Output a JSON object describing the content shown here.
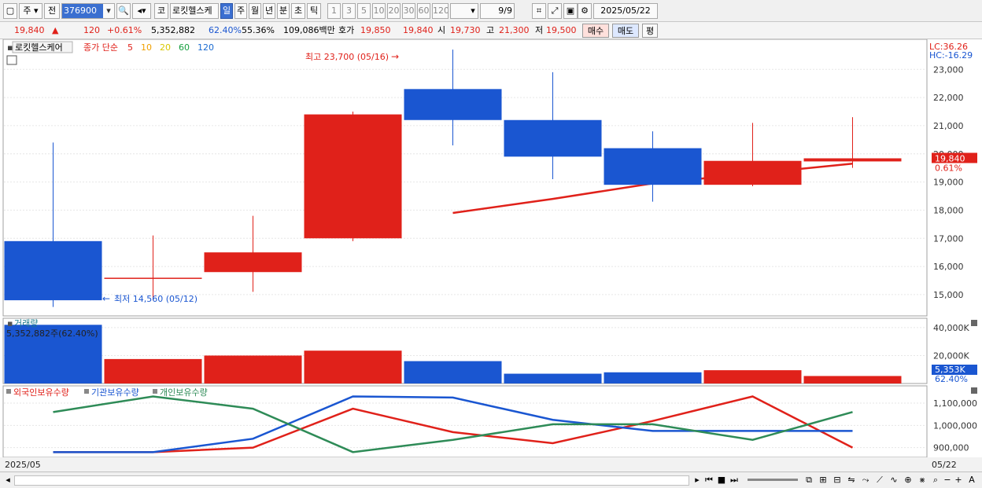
{
  "toolbar": {
    "period_main": "주",
    "prev_label": "전",
    "stock_code": "376900",
    "market_badge": "코",
    "stock_name": "로킷헬스케",
    "period_tabs": [
      "일",
      "주",
      "월",
      "년",
      "분",
      "초",
      "틱"
    ],
    "active_period": "일",
    "interval_tabs": [
      "1",
      "3",
      "5",
      "10",
      "20",
      "30",
      "60",
      "120"
    ],
    "page_counter": "9/9",
    "date": "2025/05/22"
  },
  "quote": {
    "price": "19,840",
    "change_arrow": "▲",
    "change": "120",
    "change_rate": "+0.61%",
    "volume": "5,352,882",
    "volume_ratio": "62.40%",
    "turnover_ratio": "55.36%",
    "trade_amount": "109,086백만",
    "bid_label": "호가",
    "bid_1": "19,850",
    "bid_2": "19,840",
    "open_label": "시",
    "open": "19,730",
    "high_label": "고",
    "high": "21,300",
    "low_label": "저",
    "low": "19,500",
    "buy_label": "매수",
    "sell_label": "매도",
    "avg_label": "평"
  },
  "price_panel": {
    "stock_tag": "로킷헬스케어",
    "ma_title": "종가 단순",
    "ma_periods": [
      {
        "label": "5",
        "color": "#e0211a"
      },
      {
        "label": "10",
        "color": "#f0a000"
      },
      {
        "label": "20",
        "color": "#d8c800"
      },
      {
        "label": "60",
        "color": "#18a040"
      },
      {
        "label": "120",
        "color": "#1a6ad0"
      }
    ],
    "lc_label": "LC:36.26",
    "hc_label": "HC:-16.29",
    "high_note": "최고 23,700 (05/16)",
    "low_note": "최저 14,560 (05/12)",
    "current_price_badge": "19,840",
    "current_rate_badge": "0.61%",
    "y_ticks": [
      "23,000",
      "22,000",
      "21,000",
      "20,000",
      "19,000",
      "18,000",
      "17,000",
      "16,000",
      "15,000"
    ]
  },
  "volume_panel": {
    "title": "거래량",
    "value_label": "5,352,882주(62.40%)",
    "y_ticks": [
      "40,000K",
      "20,000K"
    ],
    "badge_value": "5,353K",
    "badge_rate": "62.40%"
  },
  "holdings_panel": {
    "legend": [
      {
        "label": "외국인보유수량",
        "color": "#e0211a"
      },
      {
        "label": "기관보유수량",
        "color": "#1a56d1"
      },
      {
        "label": "개인보유수량",
        "color": "#2e8b57"
      }
    ],
    "y_ticks": [
      "1,100,000",
      "1,000,000",
      "900,000"
    ]
  },
  "axis": {
    "start_label": "2025/05",
    "end_label": "05/22"
  },
  "colors": {
    "up": "#e0211a",
    "down": "#1a56d1",
    "accent": "#3b6fd1"
  },
  "chart_data": {
    "type": "candlestick",
    "candles": [
      {
        "open": 16900,
        "high": 20400,
        "low": 14560,
        "close": 14800
      },
      {
        "open": 15600,
        "high": 17100,
        "low": 14800,
        "close": 15600
      },
      {
        "open": 15800,
        "high": 17800,
        "low": 15100,
        "close": 16500
      },
      {
        "open": 17000,
        "high": 21500,
        "low": 16900,
        "close": 21400
      },
      {
        "open": 22300,
        "high": 23700,
        "low": 20300,
        "close": 21200
      },
      {
        "open": 21200,
        "high": 22900,
        "low": 19100,
        "close": 19900
      },
      {
        "open": 20200,
        "high": 20800,
        "low": 18300,
        "close": 18900
      },
      {
        "open": 18900,
        "high": 21100,
        "low": 18850,
        "close": 19750
      },
      {
        "open": 19730,
        "high": 21300,
        "low": 19500,
        "close": 19840
      }
    ],
    "ma5": [
      null,
      null,
      null,
      null,
      17900,
      18400,
      18950,
      19300,
      19650
    ],
    "volume": [
      42000,
      17500,
      20000,
      23500,
      16000,
      7000,
      8000,
      9500,
      5353
    ],
    "volume_dir": [
      "down",
      "up",
      "up",
      "up",
      "down",
      "down",
      "down",
      "up",
      "up"
    ],
    "holdings": {
      "foreign": [
        880000,
        880000,
        900000,
        1075000,
        970000,
        920000,
        1020000,
        1130000,
        900000
      ],
      "institution": [
        880000,
        880000,
        940000,
        1130000,
        1125000,
        1025000,
        975000,
        975000,
        975000
      ],
      "individual": [
        1060000,
        1130000,
        1075000,
        880000,
        935000,
        1005000,
        1005000,
        935000,
        1060000
      ]
    },
    "y_range_price": [
      14300,
      23900
    ],
    "y_range_volume": [
      0,
      45000
    ],
    "y_range_holdings": [
      860000,
      1160000
    ]
  }
}
